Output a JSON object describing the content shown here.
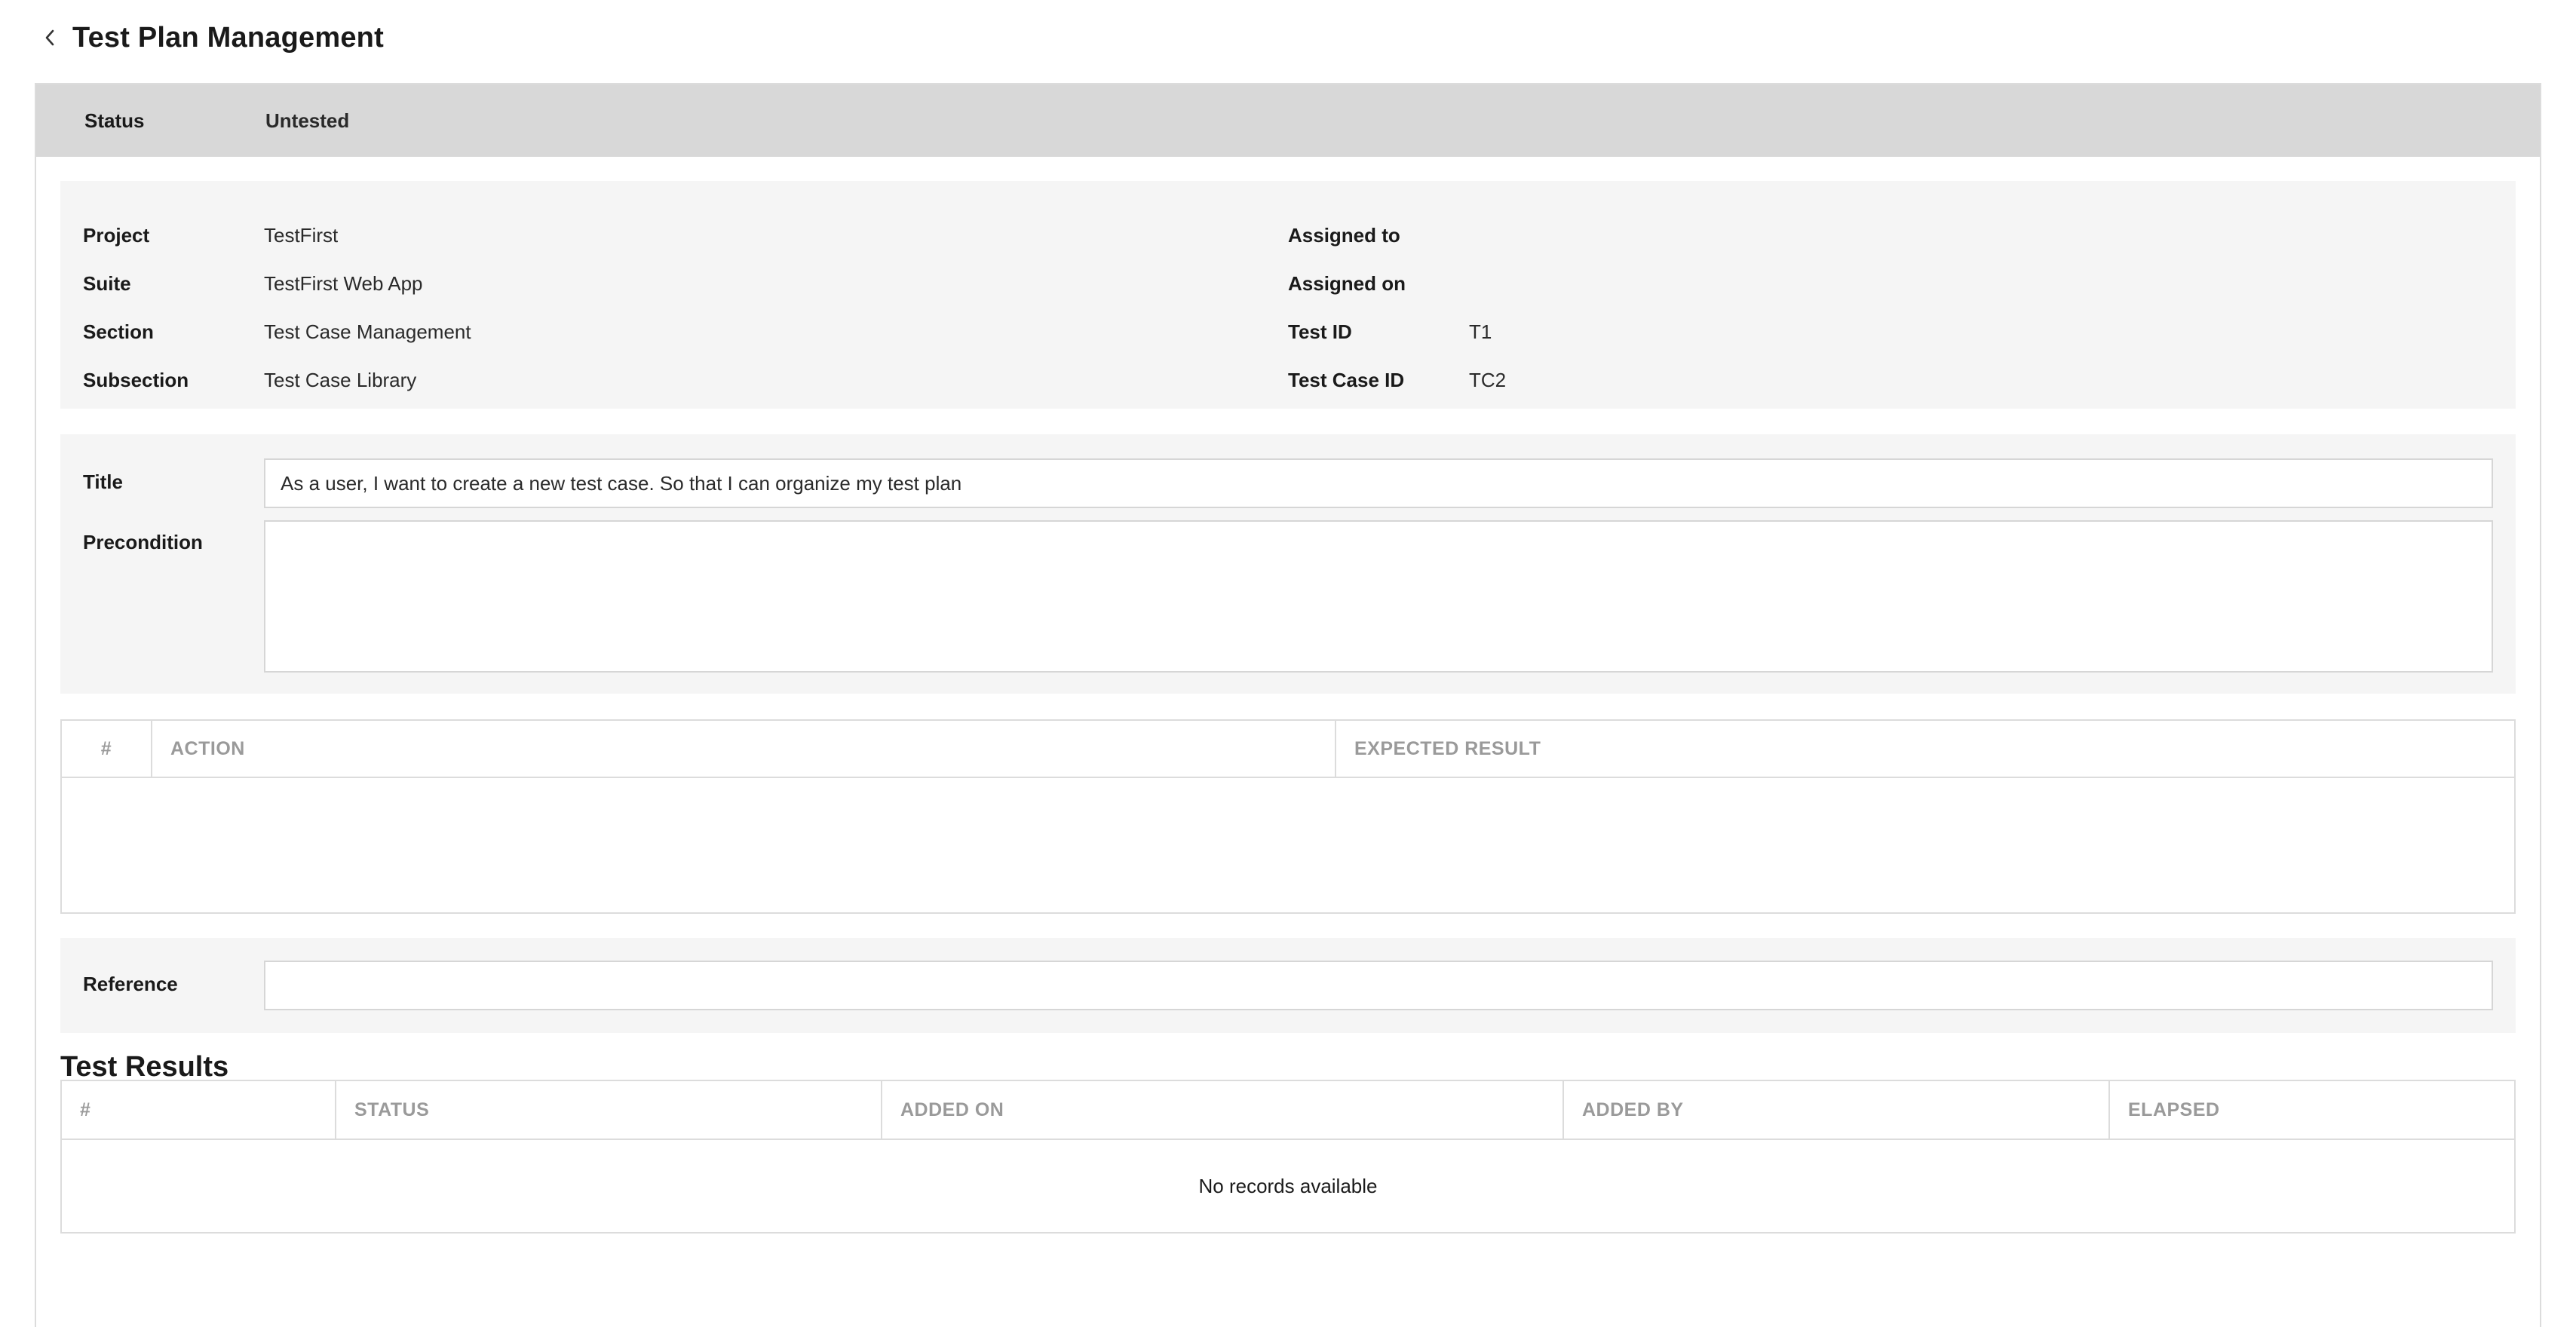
{
  "header": {
    "back_icon": "chevron-left-icon",
    "title": "Test Plan Management"
  },
  "status_bar": {
    "label": "Status",
    "value": "Untested"
  },
  "info": {
    "left": [
      {
        "label": "Project",
        "value": "TestFirst"
      },
      {
        "label": "Suite",
        "value": "TestFirst Web App"
      },
      {
        "label": "Section",
        "value": "Test Case Management"
      },
      {
        "label": "Subsection",
        "value": "Test Case Library"
      }
    ],
    "right": [
      {
        "label": "Assigned to",
        "value": ""
      },
      {
        "label": "Assigned on",
        "value": ""
      },
      {
        "label": "Test ID",
        "value": "T1"
      },
      {
        "label": "Test Case ID",
        "value": "TC2"
      }
    ]
  },
  "form": {
    "title_label": "Title",
    "title_value": "As a user, I want to create a new test case. So that I can organize my test plan",
    "precondition_label": "Precondition",
    "precondition_value": ""
  },
  "steps_table": {
    "columns": [
      "#",
      "ACTION",
      "EXPECTED RESULT"
    ],
    "rows": []
  },
  "reference": {
    "label": "Reference",
    "value": ""
  },
  "results": {
    "title": "Test Results",
    "columns": [
      "#",
      "STATUS",
      "ADDED ON",
      "ADDED BY",
      "ELAPSED"
    ],
    "empty_message": "No records available"
  }
}
